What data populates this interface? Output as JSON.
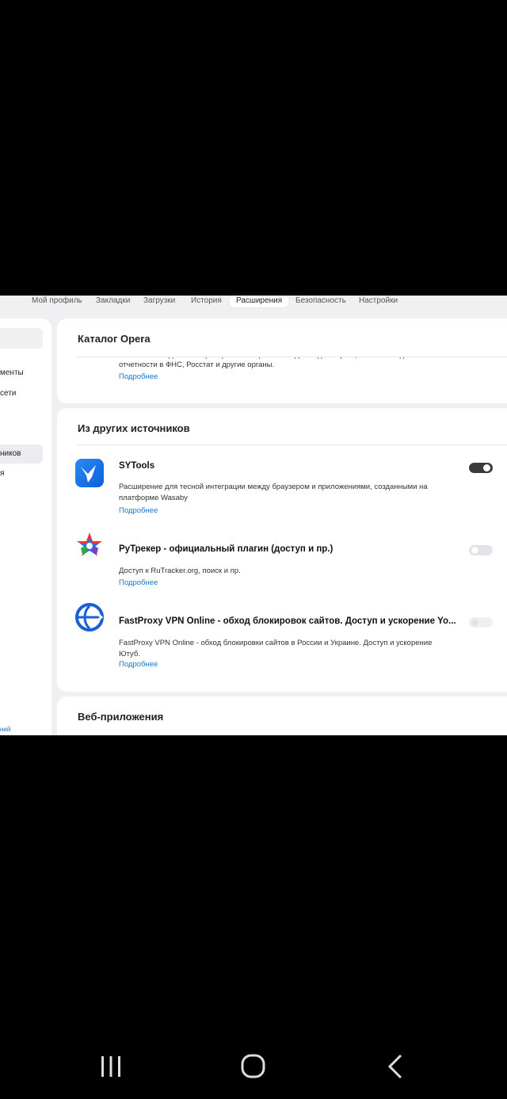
{
  "topnav": {
    "tabs": [
      {
        "label": "Мой профиль"
      },
      {
        "label": "Закладки"
      },
      {
        "label": "Загрузки"
      },
      {
        "label": "История"
      },
      {
        "label": "Расширения"
      },
      {
        "label": "Безопасность"
      },
      {
        "label": "Настройки"
      }
    ],
    "active": "Расширения"
  },
  "sidebar": {
    "items": [
      {
        "label": "менты"
      },
      {
        "label": "сети"
      },
      {
        "label": "ников"
      },
      {
        "label": "я"
      }
    ],
    "link": "ний"
  },
  "catalog": {
    "title": "Каталог Opera",
    "desc_cut": "Позволяет создавать и проверять электронные подписи для торгов, банков и подачи",
    "desc": "отчетности в ФНС, Росстат и другие органы.",
    "more": "Подробнее"
  },
  "other_sources": {
    "title": "Из других источников",
    "extensions": [
      {
        "name": "SYTools",
        "desc": "Расширение для тесной интеграции между браузером и приложениями, созданными на платформе Wasaby",
        "more": "Подробнее",
        "enabled": "on",
        "icon": "sytools-icon"
      },
      {
        "name": "РуТрекер - официальный плагин (доступ и пр.)",
        "desc": "Доступ к RuTracker.org, поиск и пр.",
        "more": "Подробнее",
        "enabled": "off",
        "icon": "rutracker-icon"
      },
      {
        "name": "FastProxy VPN Online - обход блокировок сайтов. Доступ и ускорение Yo...",
        "desc": "FastProxy VPN Online - обход блокировки сайтов в России и Украине. Доступ и ускорение Ютуб.",
        "more": "Подробнее",
        "enabled": "disabled",
        "icon": "fastproxy-icon"
      }
    ]
  },
  "webapps": {
    "title": "Веб-приложения"
  },
  "colors": {
    "accent_link": "#1a73c8",
    "toggle_on": "#3a3a3f",
    "page_bg": "#f0f0f3"
  },
  "system_nav": {
    "icons": [
      "recent-apps-icon",
      "home-icon",
      "back-icon"
    ]
  }
}
